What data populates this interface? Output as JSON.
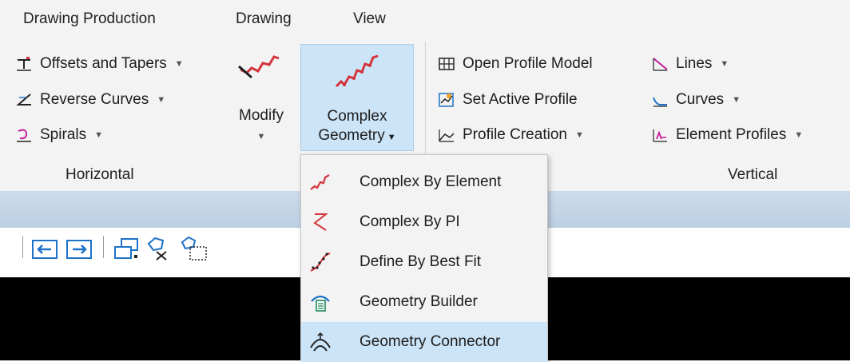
{
  "menubar": {
    "tabs": [
      "Drawing Production",
      "Drawing",
      "View"
    ]
  },
  "horizontal": {
    "items": [
      {
        "label": "Offsets and Tapers",
        "icon": "offsets-tapers-icon"
      },
      {
        "label": "Reverse Curves",
        "icon": "reverse-curves-icon"
      },
      {
        "label": "Spirals",
        "icon": "spirals-icon"
      }
    ],
    "modify_label": "Modify",
    "complex_label_1": "Complex",
    "complex_label_2": "Geometry",
    "group_label": "Horizontal"
  },
  "vertical": {
    "col1": [
      {
        "label": "Open Profile Model",
        "icon": "open-profile-model-icon"
      },
      {
        "label": "Set Active Profile",
        "icon": "set-active-profile-icon"
      },
      {
        "label": "Profile Creation",
        "icon": "profile-creation-icon"
      }
    ],
    "col2": [
      {
        "label": "Lines",
        "icon": "lines-icon"
      },
      {
        "label": "Curves",
        "icon": "curves-icon"
      },
      {
        "label": "Element Profiles",
        "icon": "element-profiles-icon"
      }
    ],
    "group_label": "Vertical"
  },
  "dropdown": {
    "items": [
      {
        "label": "Complex By Element",
        "icon": "complex-by-element-icon"
      },
      {
        "label": "Complex By PI",
        "icon": "complex-by-pi-icon"
      },
      {
        "label": "Define By Best Fit",
        "icon": "define-by-best-fit-icon"
      },
      {
        "label": "Geometry Builder",
        "icon": "geometry-builder-icon"
      },
      {
        "label": "Geometry Connector",
        "icon": "geometry-connector-icon"
      }
    ],
    "highlighted_index": 4
  },
  "colors": {
    "ribbon_bg": "#f3f3f3",
    "hover_bg": "#cce4f7",
    "accent_blue": "#1e72c8",
    "geometry_red": "#d4343c"
  }
}
